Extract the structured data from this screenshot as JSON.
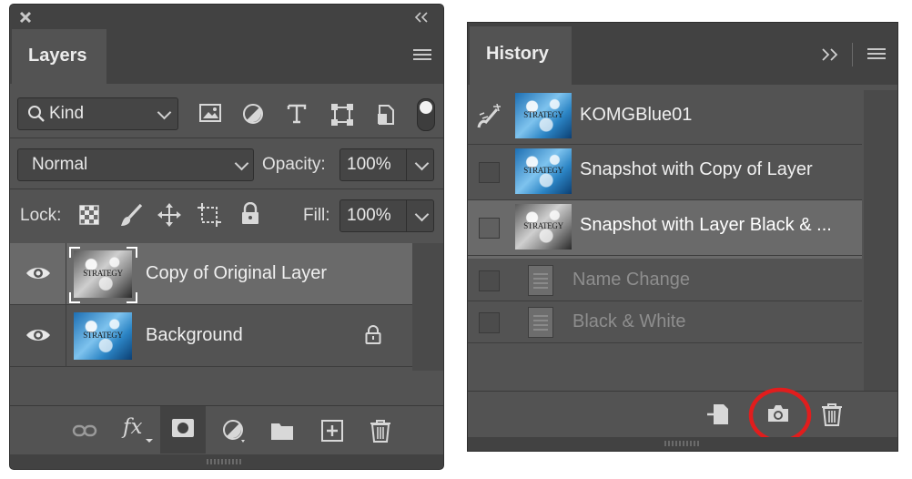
{
  "layers_panel": {
    "title": "Layers",
    "filter_kind": "Kind",
    "blend_mode": "Normal",
    "opacity_label": "Opacity:",
    "opacity_value": "100%",
    "lock_label": "Lock:",
    "fill_label": "Fill:",
    "fill_value": "100%",
    "layers": [
      {
        "name": "Copy of Original Layer",
        "thumb_text": "STRATEGY",
        "selected": true,
        "locked": false
      },
      {
        "name": "Background",
        "thumb_text": "STRATEGY",
        "selected": false,
        "locked": true
      }
    ],
    "fx_label": "fx"
  },
  "history_panel": {
    "title": "History",
    "snapshots": [
      {
        "name": "KOMGBlue01",
        "thumb_text": "STRATEGY"
      },
      {
        "name": "Snapshot with Copy of Layer",
        "thumb_text": "STRATEGY"
      },
      {
        "name": "Snapshot with Layer Black & ...",
        "thumb_text": "STRATEGY"
      }
    ],
    "states": [
      {
        "name": "Name Change"
      },
      {
        "name": "Black & White"
      }
    ]
  },
  "annotation": {
    "color": "#e11d1d",
    "target": "new-snapshot-button"
  },
  "colors": {
    "panel_bg": "#535353",
    "tab_bar_bg": "#424242",
    "selected_row": "#6a6a6a",
    "field_bg": "#454545"
  }
}
